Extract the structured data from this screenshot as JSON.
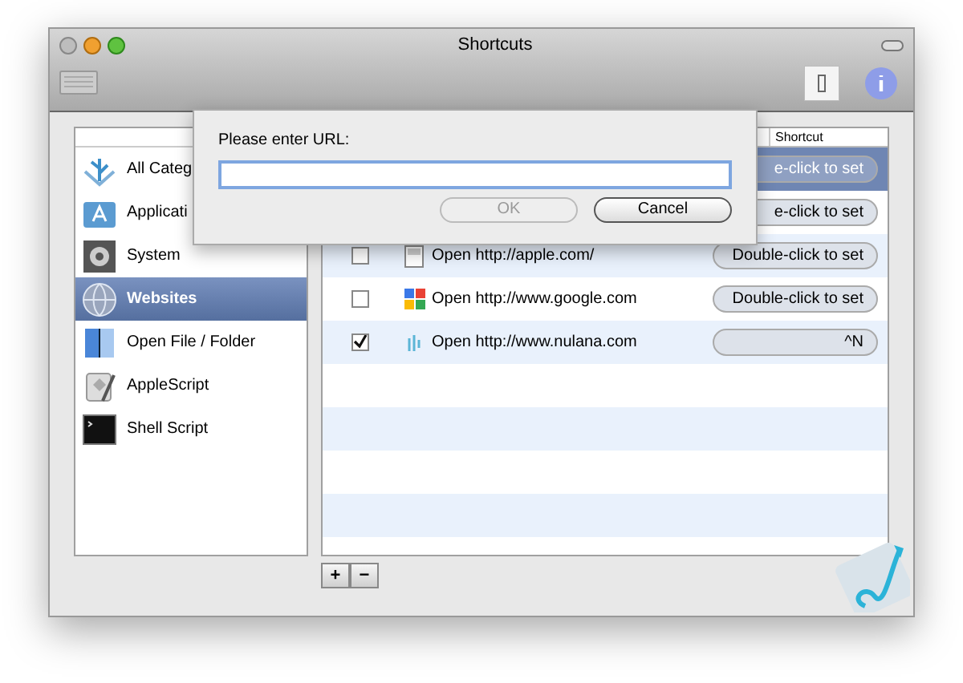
{
  "window": {
    "title": "Shortcuts"
  },
  "sidebar": {
    "items": [
      {
        "label": "All Categ",
        "kind": "all",
        "selected": false
      },
      {
        "label": "Applicati",
        "kind": "apps",
        "selected": false
      },
      {
        "label": "System",
        "kind": "system",
        "selected": false
      },
      {
        "label": "Websites",
        "kind": "web",
        "selected": true
      },
      {
        "label": "Open File / Folder",
        "kind": "finder",
        "selected": false
      },
      {
        "label": "AppleScript",
        "kind": "script",
        "selected": false
      },
      {
        "label": "Shell Script",
        "kind": "shell",
        "selected": false
      }
    ]
  },
  "table": {
    "columns": [
      "Shortcut"
    ],
    "rows": [
      {
        "selected": true,
        "shortcut": "e-click to set"
      },
      {
        "selected": false,
        "shortcut": "e-click to set"
      },
      {
        "selected": false,
        "enabled": false,
        "kind": "page",
        "action": "Open http://apple.com/",
        "shortcut": "Double-click to set"
      },
      {
        "selected": false,
        "enabled": false,
        "kind": "google",
        "action": "Open http://www.google.com",
        "shortcut": "Double-click to set"
      },
      {
        "selected": false,
        "enabled": true,
        "kind": "nulana",
        "action": "Open http://www.nulana.com",
        "shortcut": "^N"
      }
    ]
  },
  "list_buttons": [
    "+",
    "−"
  ],
  "dialog": {
    "label": "Please enter URL:",
    "buttons": [
      {
        "label": "OK",
        "disabled": true
      },
      {
        "label": "Cancel",
        "disabled": false
      }
    ]
  }
}
